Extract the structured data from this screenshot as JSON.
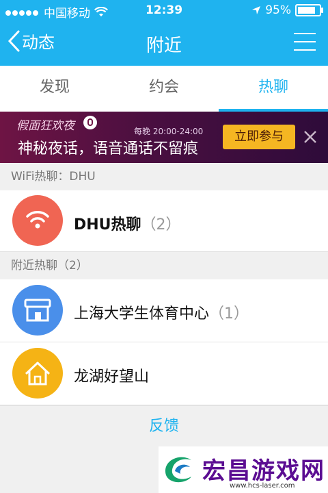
{
  "status_bar": {
    "carrier": "中国移动",
    "time": "12:39",
    "battery_text": "95%",
    "battery_level": 0.95
  },
  "nav": {
    "back_label": "动态",
    "title": "附近"
  },
  "tabs": [
    {
      "label": "发现",
      "active": false
    },
    {
      "label": "约会",
      "active": false
    },
    {
      "label": "热聊",
      "active": true
    }
  ],
  "banner": {
    "brand": "假面狂欢夜",
    "schedule": "每晚 20:00-24:00",
    "slogan": "神秘夜话，语音通话不留痕",
    "join_label": "立即参与"
  },
  "wifi_section": {
    "header": "WiFi热聊：DHU",
    "item": {
      "name": "DHU热聊",
      "count": "（2）",
      "icon": "wifi-icon",
      "color": "#f06553"
    }
  },
  "nearby_section": {
    "header": "附近热聊（2）",
    "items": [
      {
        "name": "上海大学生体育中心",
        "count": "（1）",
        "icon": "store-icon",
        "color": "#4a8fea"
      },
      {
        "name": "龙湖好望山",
        "count": "",
        "icon": "home-icon",
        "color": "#f5b315"
      }
    ]
  },
  "feedback_label": "反馈",
  "watermark": {
    "text": "宏昌游戏网",
    "url": "www.hcs-laser.com"
  },
  "colors": {
    "accent": "#1fb3ef",
    "join_button": "#f5b622"
  }
}
